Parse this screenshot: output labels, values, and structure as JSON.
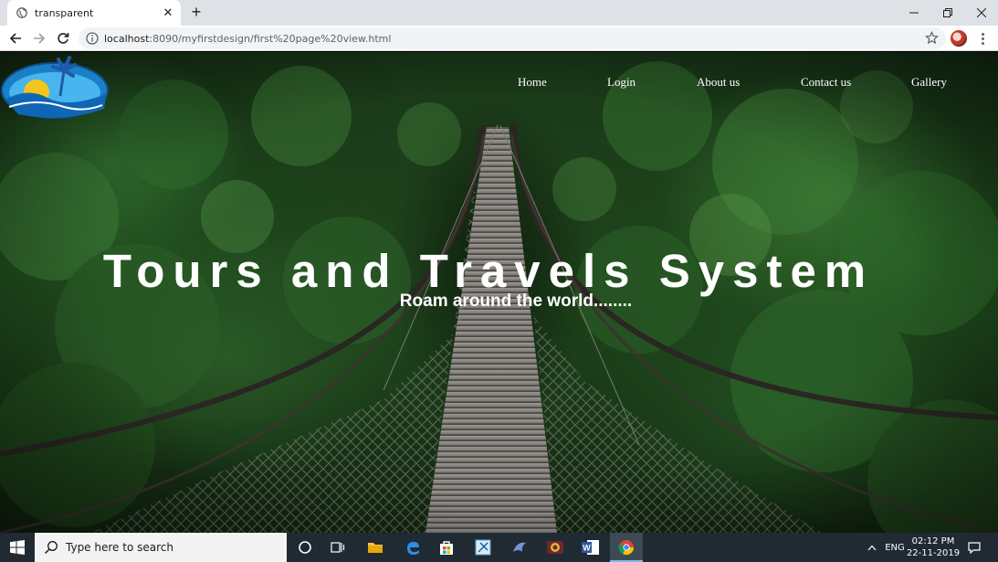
{
  "browser": {
    "tab_title": "transparent",
    "url_host": "localhost",
    "url_rest": ":8090/myfirstdesign/first%20page%20view.html"
  },
  "nav": {
    "home": "Home",
    "login": "Login",
    "about": "About us",
    "contact": "Contact us",
    "gallery": "Gallery"
  },
  "hero": {
    "title": "Tours and Travels System",
    "subtitle": "Roam around the world........"
  },
  "taskbar": {
    "search_placeholder": "Type here to search",
    "language": "ENG",
    "time": "02:12 PM",
    "date": "22-11-2019"
  },
  "colors": {
    "accent_text": "#ffffff",
    "taskbar_bg": "#1f2a33",
    "tab_strip": "#dee1e6"
  }
}
